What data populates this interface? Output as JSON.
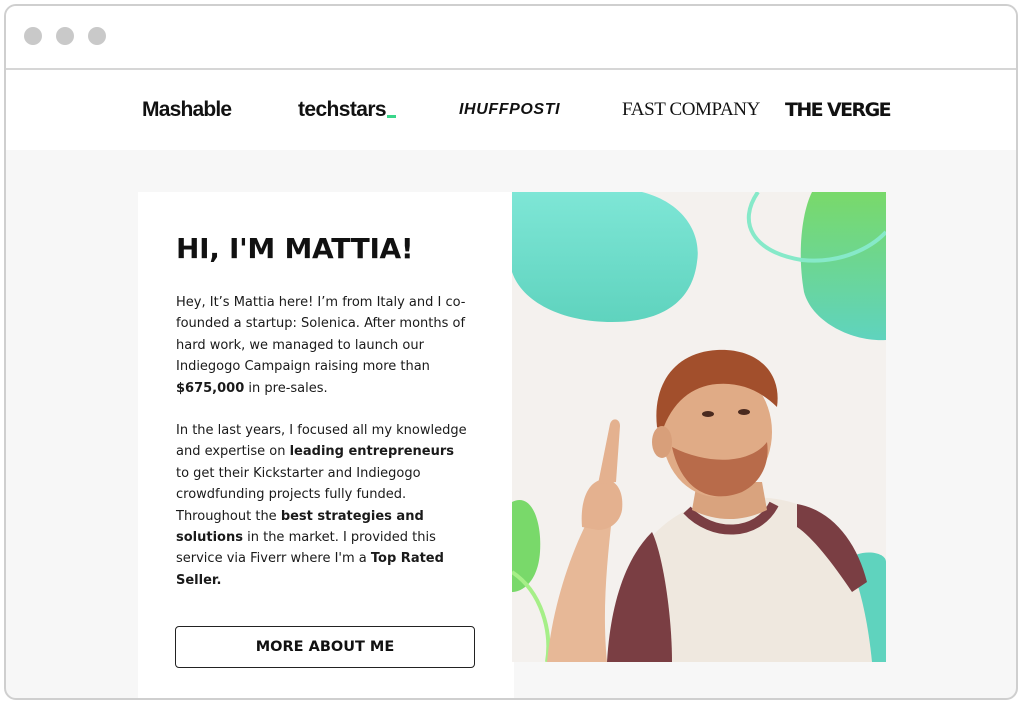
{
  "window": {
    "controls": [
      "dot",
      "dot",
      "dot"
    ]
  },
  "press_logos": {
    "mashable": "Mashable",
    "techstars": "techstars",
    "huffpost": "IHUFFPOSTI",
    "fastcompany": "FAST COMPANY",
    "verge": "THE VERGE"
  },
  "about": {
    "heading": "HI, I'M MATTIA!",
    "p1_text": "Hey, It’s Mattia here! I’m from Italy and I co-founded a startup: Solenica. After months of hard work, we managed to launch our Indiegogo Campaign raising more than ",
    "p1_bold": "$675,000",
    "p1_end": " in pre-sales.",
    "p2_a": "In the last years, I focused all my knowledge and expertise on ",
    "p2_b": "leading entrepreneurs",
    "p2_c": " to get their Kickstarter and Indiegogo crowdfunding projects fully funded. Throughout the ",
    "p2_d": "best strategies and solutions",
    "p2_e": " in the market. I provided this service via Fiverr where I'm a ",
    "p2_f": "Top Rated Seller.",
    "button_label": "MORE ABOUT ME"
  },
  "colors": {
    "teal": "#5fd3be",
    "mint": "#7ee6d6",
    "green": "#7bd96a",
    "shirt": "#efe8df",
    "sleeve": "#7a3e43"
  }
}
